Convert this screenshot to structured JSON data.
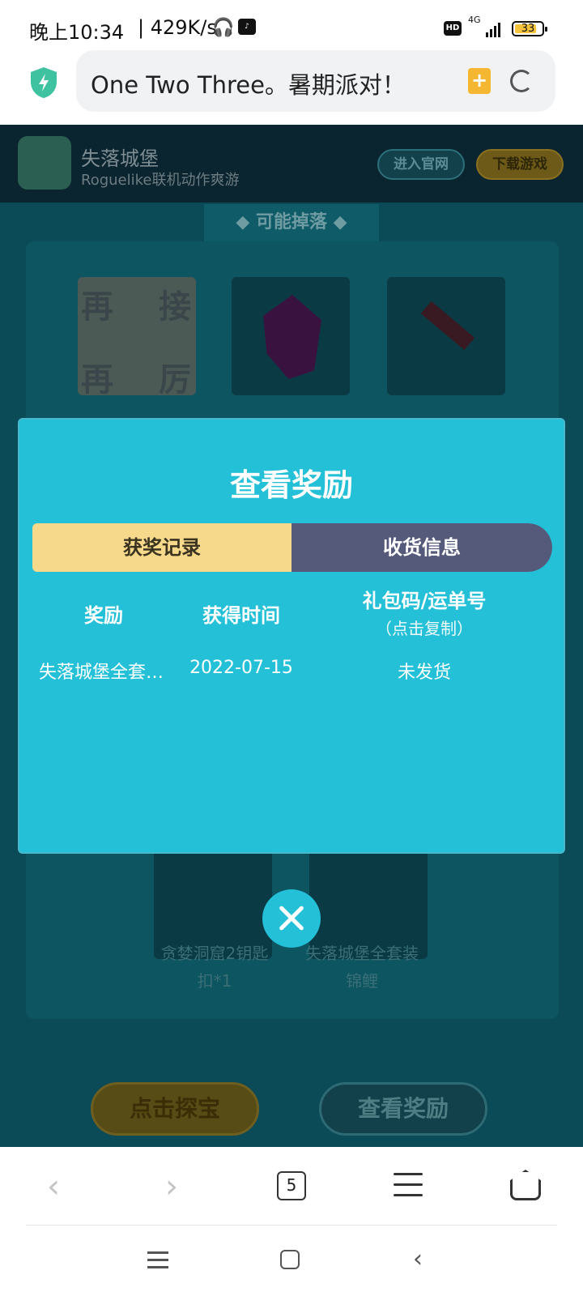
{
  "status_bar": {
    "time": "晚上10:34",
    "network_speed": "| 429K/s",
    "hd_label": "HD",
    "signal_label": "4G",
    "battery_level": "33"
  },
  "browser": {
    "url_text": "One Two Three。暑期派对！",
    "bookmark_symbol": "+",
    "tab_count": "5"
  },
  "page": {
    "game_name": "失落城堡",
    "game_subtitle": "Roguelike联机动作爽游",
    "official_button": "进入官网",
    "download_button": "下载游戏",
    "drops_title": "◆ 可能掉落 ◆",
    "tile_glyphs": [
      "再",
      "接",
      "再",
      "厉"
    ],
    "items": [
      {
        "label_line1": "贪婪洞窟2钥匙",
        "label_line2": "扣*1"
      },
      {
        "label_line1": "失落城堡全套装",
        "label_line2": "锦鲤"
      }
    ],
    "explore_button": "点击探宝",
    "view_rewards_button": "查看奖励"
  },
  "modal": {
    "title": "查看奖励",
    "tab_records": "获奖记录",
    "tab_shipping": "收货信息",
    "columns": {
      "reward": "奖励",
      "time": "获得时间",
      "code": "礼包码/运单号",
      "code_hint": "（点击复制）"
    },
    "rows": [
      {
        "reward": "失落城堡全套…",
        "time": "2022-07-15",
        "code": "未发货"
      }
    ]
  },
  "colors": {
    "modal_bg": "#24c0d8",
    "active_tab": "#f7d98b",
    "inactive_tab": "#555a7b",
    "page_dim": "#0b4a57"
  }
}
